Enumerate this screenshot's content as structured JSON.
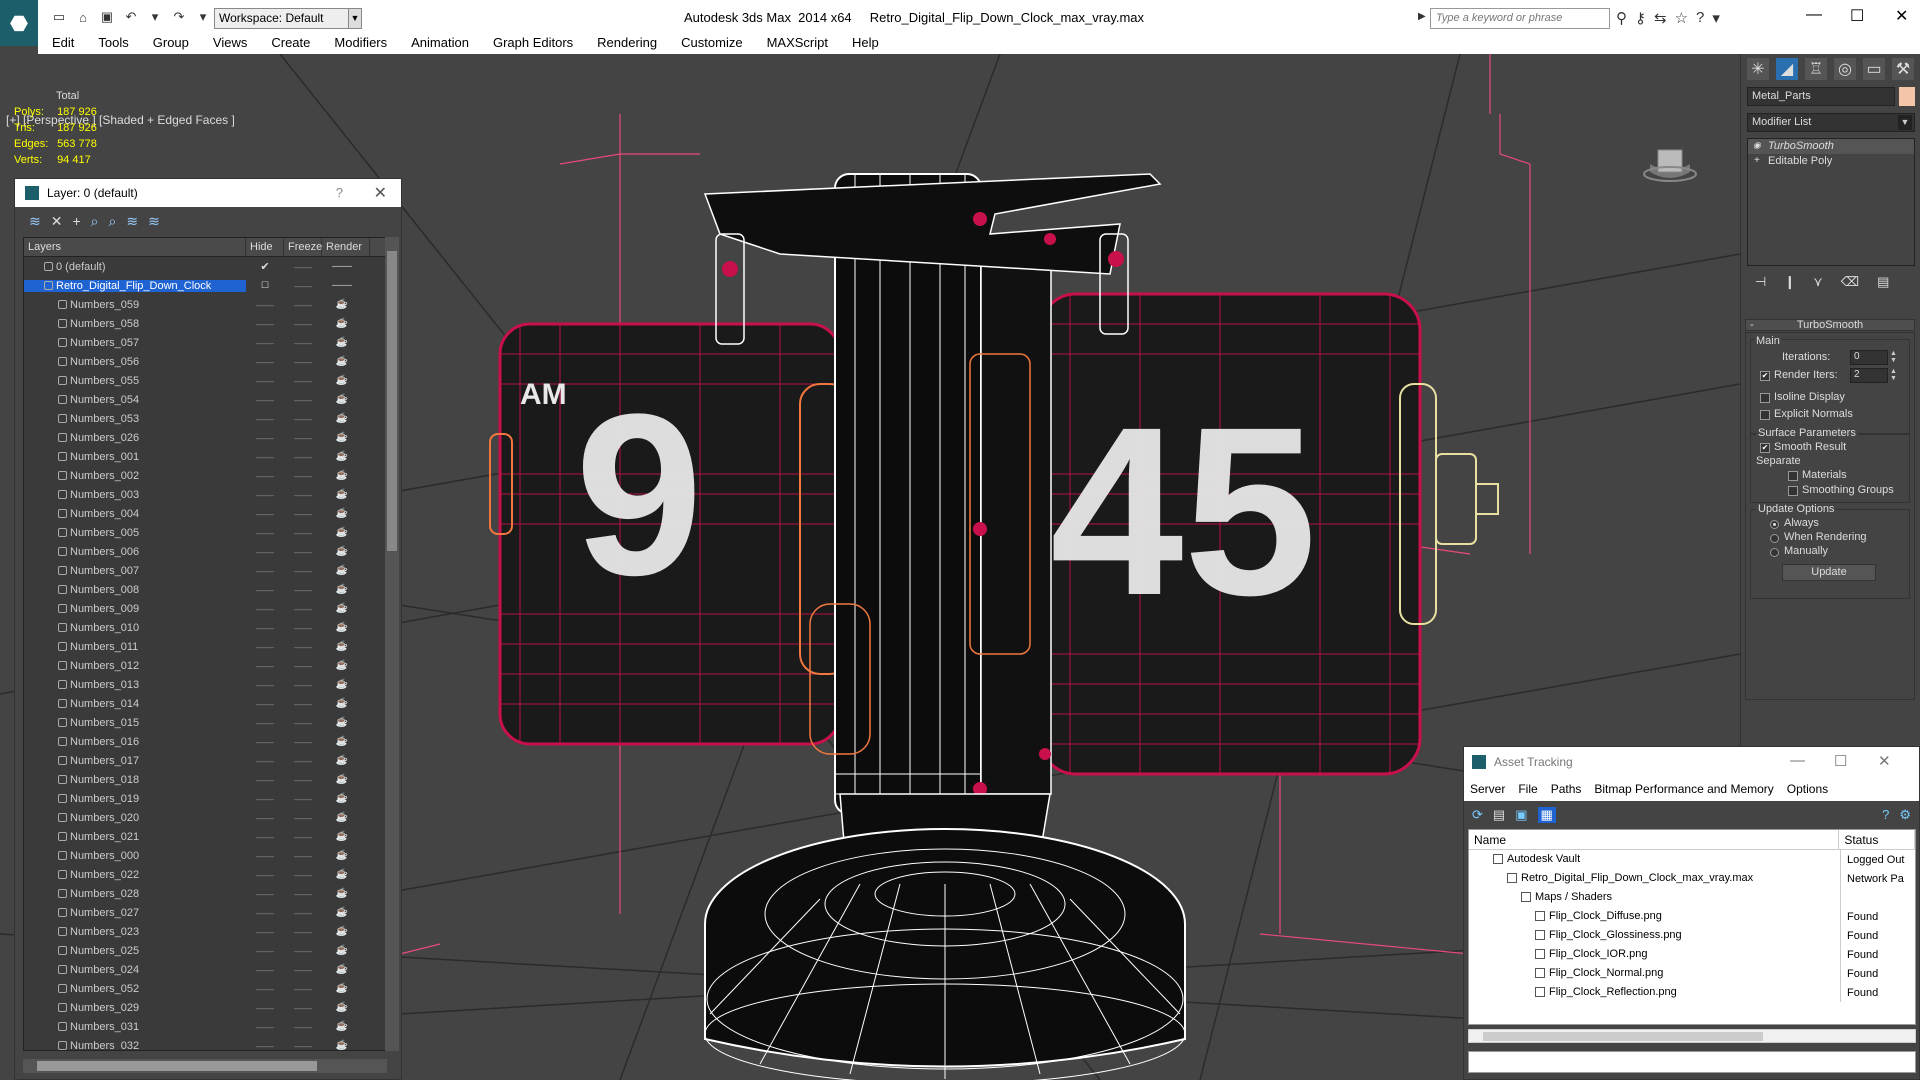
{
  "app": {
    "workspace": "Workspace: Default",
    "title": "Autodesk 3ds Max  2014 x64     Retro_Digital_Flip_Down_Clock_max_vray.max",
    "search_placeholder": "Type a keyword or phrase"
  },
  "menu": [
    "Edit",
    "Tools",
    "Group",
    "Views",
    "Create",
    "Modifiers",
    "Animation",
    "Graph Editors",
    "Rendering",
    "Customize",
    "MAXScript",
    "Help"
  ],
  "viewport": {
    "label": "[+] [Perspective ] [Shaded + Edged Faces ]",
    "stats": {
      "header": "Total",
      "rows": [
        {
          "label": "Polys:",
          "value": "187 926"
        },
        {
          "label": "Tris:",
          "value": "187 926"
        },
        {
          "label": "Edges:",
          "value": "563 778"
        },
        {
          "label": "Verts:",
          "value": "94 417"
        }
      ]
    },
    "clock_digits": [
      "9",
      "45"
    ],
    "clock_prefix": "AM"
  },
  "layer_window": {
    "title": "Layer: 0 (default)",
    "help": "?",
    "columns": [
      "Layers",
      "Hide",
      "Freeze",
      "Render"
    ],
    "top_rows": [
      "0 (default)",
      "Retro_Digital_Flip_Down_Clock"
    ],
    "items": [
      "Numbers_059",
      "Numbers_058",
      "Numbers_057",
      "Numbers_056",
      "Numbers_055",
      "Numbers_054",
      "Numbers_053",
      "Numbers_026",
      "Numbers_001",
      "Numbers_002",
      "Numbers_003",
      "Numbers_004",
      "Numbers_005",
      "Numbers_006",
      "Numbers_007",
      "Numbers_008",
      "Numbers_009",
      "Numbers_010",
      "Numbers_011",
      "Numbers_012",
      "Numbers_013",
      "Numbers_014",
      "Numbers_015",
      "Numbers_016",
      "Numbers_017",
      "Numbers_018",
      "Numbers_019",
      "Numbers_020",
      "Numbers_021",
      "Numbers_000",
      "Numbers_022",
      "Numbers_028",
      "Numbers_027",
      "Numbers_023",
      "Numbers_025",
      "Numbers_024",
      "Numbers_052",
      "Numbers_029",
      "Numbers_031",
      "Numbers_032"
    ]
  },
  "command_panel": {
    "object_name": "Metal_Parts",
    "modifier_list": "Modifier List",
    "stack": [
      "TurboSmooth",
      "Editable Poly"
    ],
    "rollout_title": "TurboSmooth",
    "main_label": "Main",
    "iterations_label": "Iterations:",
    "iterations_value": "0",
    "render_iters_label": "Render Iters:",
    "render_iters_value": "2",
    "isoline_label": "Isoline Display",
    "explicit_normals_label": "Explicit Normals",
    "surface_params_label": "Surface Parameters",
    "smooth_result_label": "Smooth Result",
    "separate_label": "Separate",
    "materials_label": "Materials",
    "smoothing_groups_label": "Smoothing Groups",
    "update_options_label": "Update Options",
    "always_label": "Always",
    "when_rendering_label": "When Rendering",
    "manually_label": "Manually",
    "update_button": "Update"
  },
  "asset_tracking": {
    "title": "Asset Tracking",
    "menu": [
      "Server",
      "File",
      "Paths",
      "Bitmap Performance and Memory",
      "Options"
    ],
    "columns": [
      "Name",
      "Status"
    ],
    "rows": [
      {
        "name": "Autodesk Vault",
        "status": "Logged Out",
        "indent": 1
      },
      {
        "name": "Retro_Digital_Flip_Down_Clock_max_vray.max",
        "status": "Network Pa",
        "indent": 2
      },
      {
        "name": "Maps / Shaders",
        "status": "",
        "indent": 3
      },
      {
        "name": "Flip_Clock_Diffuse.png",
        "status": "Found",
        "indent": 4
      },
      {
        "name": "Flip_Clock_Glossiness.png",
        "status": "Found",
        "indent": 4
      },
      {
        "name": "Flip_Clock_IOR.png",
        "status": "Found",
        "indent": 4
      },
      {
        "name": "Flip_Clock_Normal.png",
        "status": "Found",
        "indent": 4
      },
      {
        "name": "Flip_Clock_Reflection.png",
        "status": "Found",
        "indent": 4
      }
    ]
  },
  "colors": {
    "accent": "#1f63d2",
    "wire": "#c8104a",
    "stats": "#ffff00",
    "grid": "#2a2a2a"
  }
}
